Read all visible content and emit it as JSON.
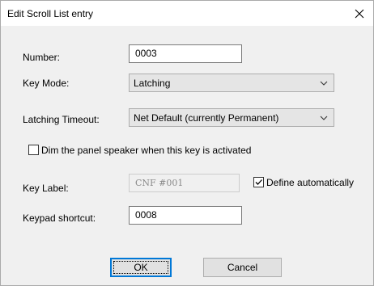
{
  "window": {
    "title": "Edit Scroll List entry",
    "close_icon": "close-icon"
  },
  "form": {
    "number": {
      "label": "Number:",
      "value": "0003"
    },
    "key_mode": {
      "label": "Key Mode:",
      "value": "Latching"
    },
    "latching_timeout": {
      "label": "Latching Timeout:",
      "value": "Net Default (currently Permanent)"
    },
    "dim_speaker": {
      "label": "Dim the panel speaker when this key is activated",
      "checked": false
    },
    "key_label": {
      "label": "Key Label:",
      "value": "CNF #001",
      "enabled": false
    },
    "define_automatically": {
      "label": "Define automatically",
      "checked": true
    },
    "keypad_shortcut": {
      "label": "Keypad shortcut:",
      "value": "0008"
    }
  },
  "buttons": {
    "ok": "OK",
    "cancel": "Cancel"
  },
  "colors": {
    "dialog_bg": "#f0f0f0",
    "titlebar_bg": "#ffffff",
    "default_button_accent": "#0078d7"
  }
}
